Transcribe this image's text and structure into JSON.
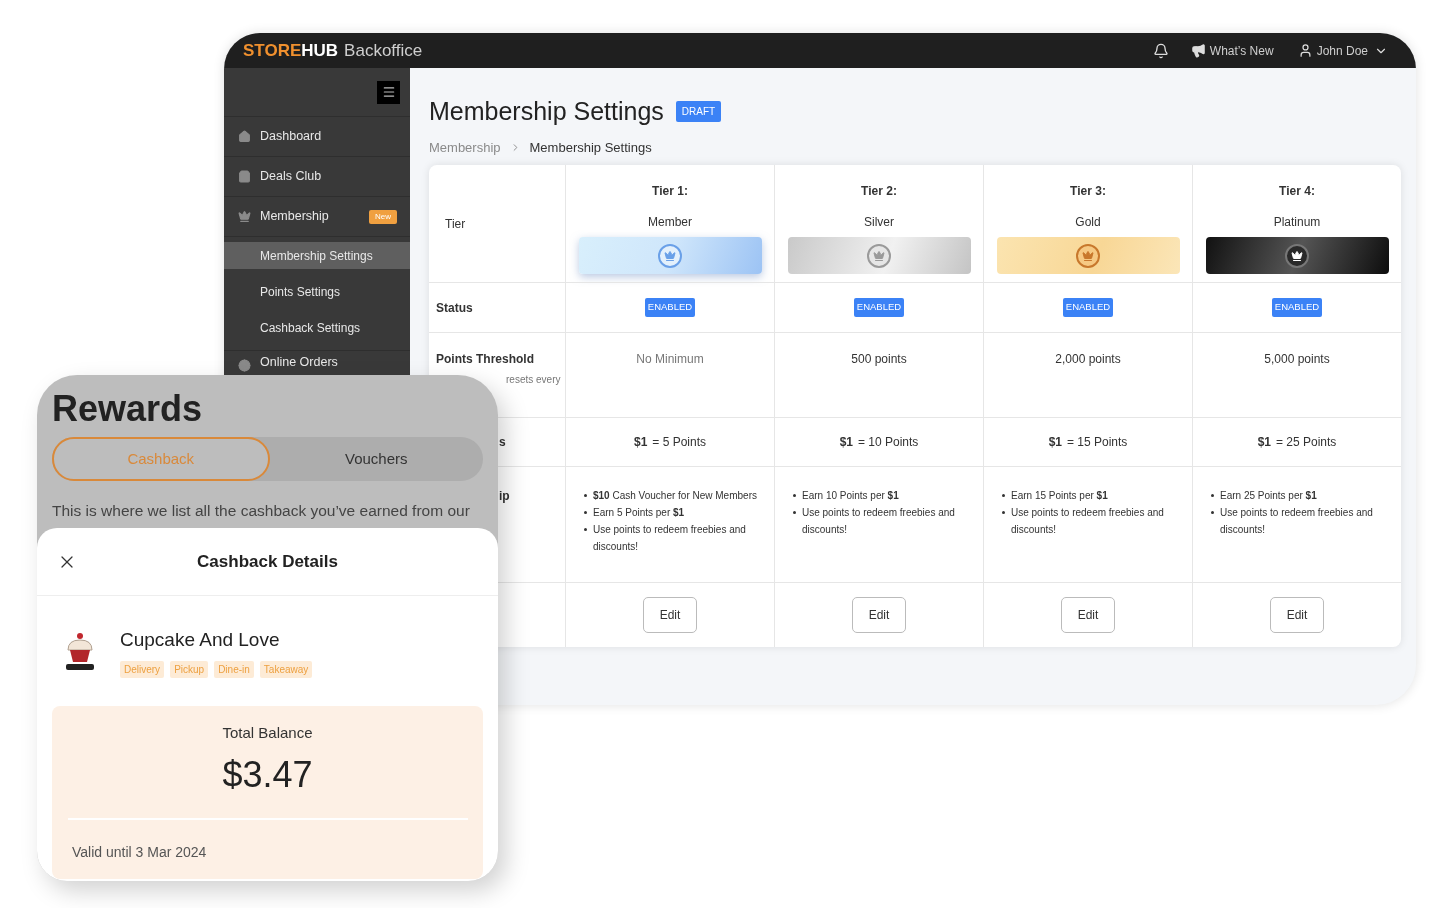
{
  "header": {
    "brand_store": "STORE",
    "brand_hub": "HUB",
    "brand_product": "Backoffice",
    "whats_new": "What’s New",
    "user": "John Doe"
  },
  "sidebar": {
    "items": [
      {
        "label": "Dashboard",
        "kind": "main",
        "selected": false
      },
      {
        "label": "Deals Club",
        "kind": "main",
        "selected": false
      },
      {
        "label": "Membership",
        "kind": "main",
        "selected": false,
        "badge": "New"
      },
      {
        "label": "Membership Settings",
        "kind": "sub",
        "selected": true
      },
      {
        "label": "Points Settings",
        "kind": "sub",
        "selected": false
      },
      {
        "label": "Cashback Settings",
        "kind": "sub",
        "selected": false
      },
      {
        "label": "Online Orders",
        "kind": "last",
        "selected": false
      }
    ]
  },
  "page": {
    "title": "Membership Settings",
    "badge": "DRAFT",
    "breadcrumb": [
      "Membership",
      "Membership Settings"
    ]
  },
  "table": {
    "row_labels": {
      "tier": "Tier",
      "status": "Status",
      "threshold": "Points Threshold",
      "threshold_note": "resets every",
      "rate": "s",
      "benefits": "ip"
    },
    "tiers": [
      {
        "heading": "Tier 1:",
        "name": "Member",
        "kind": "member",
        "status": "ENABLED",
        "threshold": "No Minimum",
        "threshold_muted": true,
        "rate_amount": "$1",
        "rate_text": "= 5 Points",
        "benefits": [
          "**$10** Cash Voucher for New Members",
          "Earn 5 Points per **$1**",
          "Use points to redeem freebies and discounts!"
        ],
        "action": "Edit"
      },
      {
        "heading": "Tier 2:",
        "name": "Silver",
        "kind": "silver",
        "status": "ENABLED",
        "threshold": "500 points",
        "threshold_muted": false,
        "rate_amount": "$1",
        "rate_text": "= 10 Points",
        "benefits": [
          "Earn 10 Points per **$1**",
          "Use points to redeem freebies and discounts!"
        ],
        "action": "Edit"
      },
      {
        "heading": "Tier 3:",
        "name": "Gold",
        "kind": "gold",
        "status": "ENABLED",
        "threshold": "2,000 points",
        "threshold_muted": false,
        "rate_amount": "$1",
        "rate_text": "= 15 Points",
        "benefits": [
          "Earn 15 Points per **$1**",
          "Use points to redeem freebies and discounts!"
        ],
        "action": "Edit"
      },
      {
        "heading": "Tier 4:",
        "name": "Platinum",
        "kind": "platinum",
        "status": "ENABLED",
        "threshold": "5,000 points",
        "threshold_muted": false,
        "rate_amount": "$1",
        "rate_text": "= 25 Points",
        "benefits": [
          "Earn 25 Points per **$1**",
          "Use points to redeem freebies and discounts!"
        ],
        "action": "Edit"
      }
    ]
  },
  "phone": {
    "title": "Rewards",
    "tabs": [
      {
        "label": "Cashback",
        "selected": true
      },
      {
        "label": "Vouchers",
        "selected": false
      }
    ],
    "description": "This is where we list all the cashback you’ve earned from our",
    "sheet": {
      "title": "Cashback Details",
      "store": "Cupcake And Love",
      "tags": [
        "Delivery",
        "Pickup",
        "Dine-in",
        "Takeaway"
      ],
      "balance_label": "Total Balance",
      "balance": "$3.47",
      "valid": "Valid until 3 Mar 2024"
    }
  }
}
